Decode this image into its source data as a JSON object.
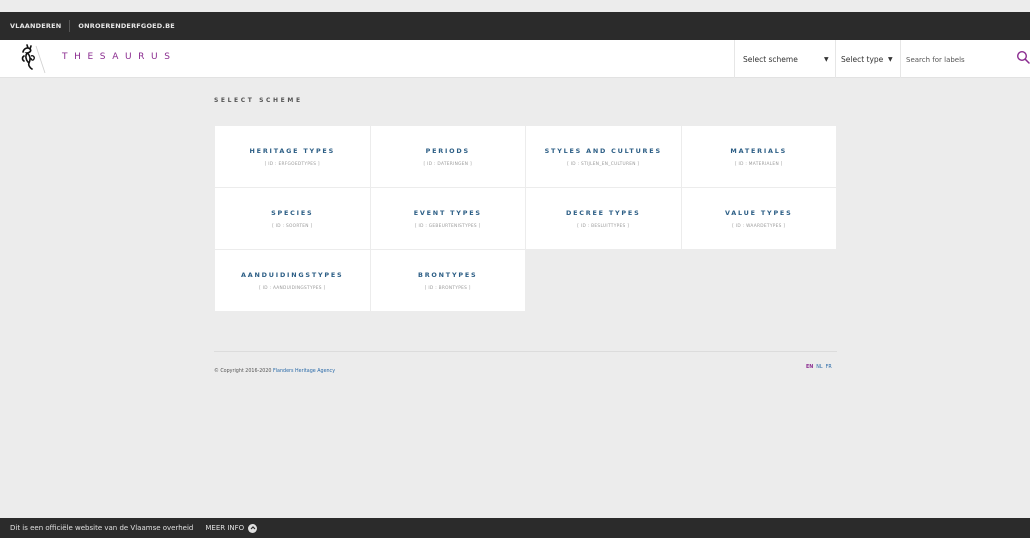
{
  "top_bar": {
    "link1": "VLAANDEREN",
    "link2": "ONROERENDERFGOED.BE"
  },
  "header": {
    "brand": "THESAURUS",
    "select_scheme": "Select scheme",
    "select_type": "Select type",
    "search_placeholder": "Search for labels",
    "brand_color": "#8a2b8f",
    "icons": [
      "flemish-lion-logo-icon",
      "chevron-down-icon",
      "search-icon"
    ]
  },
  "main": {
    "section_title": "SELECT SCHEME",
    "schemes": [
      {
        "title": "HERITAGE TYPES",
        "id": "[ ID : ERFGOEDTYPES ]"
      },
      {
        "title": "PERIODS",
        "id": "[ ID : DATERINGEN ]"
      },
      {
        "title": "STYLES AND CULTURES",
        "id": "[ ID : STIJLEN_EN_CULTUREN ]"
      },
      {
        "title": "MATERIALS",
        "id": "[ ID : MATERIALEN ]"
      },
      {
        "title": "SPECIES",
        "id": "[ ID : SOORTEN ]"
      },
      {
        "title": "EVENT TYPES",
        "id": "[ ID : GEBEURTENISTYPES ]"
      },
      {
        "title": "DECREE TYPES",
        "id": "[ ID : BESLUITTYPES ]"
      },
      {
        "title": "VALUE TYPES",
        "id": "[ ID : WAARDETYPES ]"
      },
      {
        "title": "AANDUIDINGSTYPES",
        "id": "[ ID : AANDUIDINGSTYPES ]"
      },
      {
        "title": "BRONTYPES",
        "id": "[ ID : BRONTYPES ]"
      }
    ],
    "title_color": "#2c5e85"
  },
  "footer": {
    "copyright_prefix": "© Copyright 2016-2020",
    "copyright_link": "Flanders Heritage Agency",
    "languages": [
      "EN",
      "NL",
      "FR"
    ],
    "active_language": "EN"
  },
  "bottom_bar": {
    "text": "Dit is een officiële website van de Vlaamse overheid",
    "more": "MEER INFO"
  }
}
